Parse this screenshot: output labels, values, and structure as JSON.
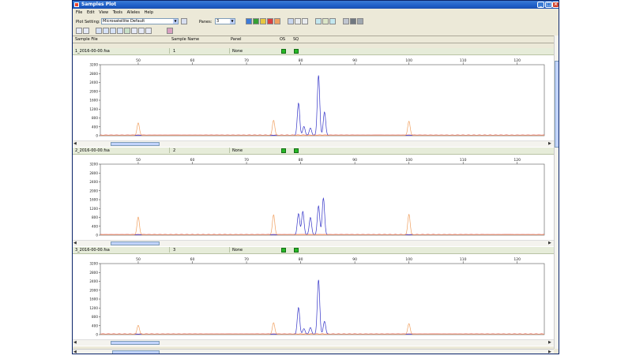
{
  "window": {
    "title": "Samples Plot",
    "min_label": "_",
    "max_label": "□",
    "close_label": "×"
  },
  "menu": [
    "File",
    "Edit",
    "View",
    "Tools",
    "Alleles",
    "Help"
  ],
  "toolbar": {
    "plot_setting_label": "Plot Setting:",
    "plot_setting_value": "Microsatellite Default",
    "panes_label": "Panes:",
    "panes_value": "3"
  },
  "columns": {
    "sample_file": "Sample File",
    "sample_name": "Sample Name",
    "panel": "Panel",
    "os": "OS",
    "sq": "SQ"
  },
  "colors": {
    "blue_trace": "#3535c8",
    "orange_trace": "#f0a060",
    "red_trace": "#e03030",
    "flag_green": "#26b826"
  },
  "panes": [
    {
      "sample_file": "1_2016-00-00.fsa",
      "sample_name": "1",
      "panel": "None",
      "chart_data": {
        "type": "line",
        "x_ticks": [
          "50",
          "60",
          "70",
          "80",
          "90",
          "100",
          "110",
          "120"
        ],
        "y_ticks": [
          "0",
          "400",
          "800",
          "1200",
          "1600",
          "2000",
          "2400",
          "2800",
          "3200"
        ],
        "xlim": [
          43,
          125
        ],
        "ylim": [
          0,
          3200
        ],
        "series": [
          {
            "color": "blue",
            "peaks": [
              [
                79.6,
                1450
              ],
              [
                80.6,
                400
              ],
              [
                81.8,
                330
              ],
              [
                83.3,
                2700
              ],
              [
                84.4,
                1050
              ]
            ]
          },
          {
            "color": "orange",
            "peaks": [
              [
                50,
                560
              ],
              [
                75,
                680
              ],
              [
                100,
                640
              ]
            ]
          }
        ]
      }
    },
    {
      "sample_file": "2_2016-00-00.fsa",
      "sample_name": "2",
      "panel": "None",
      "chart_data": {
        "type": "line",
        "x_ticks": [
          "50",
          "60",
          "70",
          "80",
          "90",
          "100",
          "110",
          "120"
        ],
        "y_ticks": [
          "0",
          "400",
          "800",
          "1200",
          "1600",
          "2000",
          "2400",
          "2800",
          "3200"
        ],
        "xlim": [
          43,
          125
        ],
        "ylim": [
          0,
          3200
        ],
        "series": [
          {
            "color": "blue",
            "peaks": [
              [
                79.6,
                950
              ],
              [
                80.4,
                1050
              ],
              [
                81.8,
                780
              ],
              [
                83.3,
                1300
              ],
              [
                84.2,
                1650
              ]
            ]
          },
          {
            "color": "orange",
            "peaks": [
              [
                50,
                800
              ],
              [
                75,
                900
              ],
              [
                100,
                920
              ]
            ]
          }
        ]
      }
    },
    {
      "sample_file": "3_2016-00-00.fsa",
      "sample_name": "3",
      "panel": "None",
      "chart_data": {
        "type": "line",
        "x_ticks": [
          "50",
          "60",
          "70",
          "80",
          "90",
          "100",
          "110",
          "120"
        ],
        "y_ticks": [
          "0",
          "400",
          "800",
          "1200",
          "1600",
          "2000",
          "2400",
          "2800",
          "3200"
        ],
        "xlim": [
          43,
          125
        ],
        "ylim": [
          0,
          3200
        ],
        "series": [
          {
            "color": "blue",
            "peaks": [
              [
                79.6,
                1200
              ],
              [
                80.6,
                250
              ],
              [
                81.8,
                300
              ],
              [
                83.3,
                2450
              ],
              [
                84.4,
                580
              ]
            ]
          },
          {
            "color": "orange",
            "peaks": [
              [
                50,
                400
              ],
              [
                75,
                520
              ],
              [
                100,
                480
              ]
            ]
          }
        ]
      }
    }
  ]
}
